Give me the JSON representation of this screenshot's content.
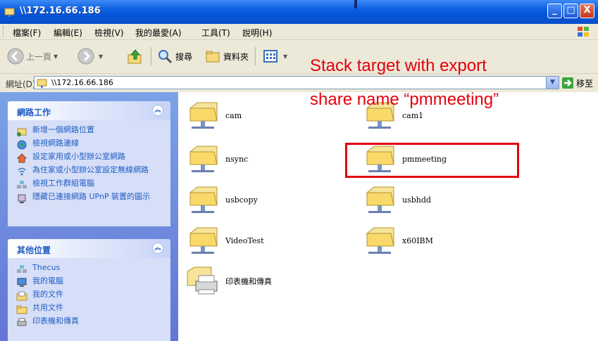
{
  "window": {
    "title": "\\\\172.16.66.186",
    "buttons": {
      "minimize": "_",
      "maximize": "□",
      "close": "X"
    }
  },
  "menubar": {
    "items": [
      "檔案(F)",
      "編輯(E)",
      "檢視(V)",
      "我的最愛(A)",
      "工具(T)",
      "說明(H)"
    ]
  },
  "toolbar": {
    "back_label": "上一頁",
    "search_label": "搜尋",
    "folders_label": "資料夾"
  },
  "addressbar": {
    "label": "網址(D)",
    "value": "\\\\172.16.66.186",
    "go_label": "移至"
  },
  "taskpane": {
    "network_tasks": {
      "title": "網路工作",
      "items": [
        "新增一個網路位置",
        "檢視網路連線",
        "設定家用或小型辦公室網路",
        "為住家或小型辦公室設定無線網路",
        "檢視工作群組電腦",
        "隱藏已連接網路 UPnP 裝置的圖示"
      ]
    },
    "other_places": {
      "title": "其他位置",
      "items": [
        "Thecus",
        "我的電腦",
        "我的文件",
        "共用文件",
        "印表機和傳真"
      ]
    }
  },
  "shares": [
    "cam",
    "cam1",
    "nsync",
    "pmmeeting",
    "usbcopy",
    "usbhdd",
    "VideoTest",
    "x60IBM",
    "印表機和傳真"
  ],
  "annotation": {
    "line1": "Stack target with export",
    "line2": "share name “pmmeeting”"
  }
}
